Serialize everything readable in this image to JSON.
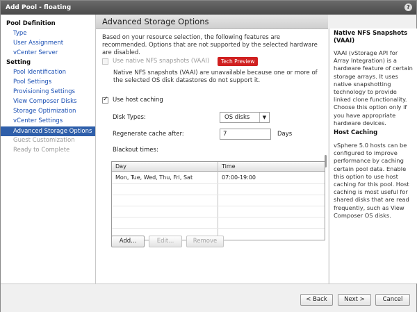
{
  "window": {
    "title": "Add Pool - floating",
    "help_glyph": "?"
  },
  "sidebar": {
    "sections": [
      {
        "label": "Pool Definition"
      },
      {
        "label": "Setting"
      }
    ],
    "items": [
      {
        "label": "Type",
        "state": "link"
      },
      {
        "label": "User Assignment",
        "state": "link"
      },
      {
        "label": "vCenter Server",
        "state": "link"
      },
      {
        "label": "Pool Identification",
        "state": "link"
      },
      {
        "label": "Pool Settings",
        "state": "link"
      },
      {
        "label": "Provisioning Settings",
        "state": "link"
      },
      {
        "label": "View Composer Disks",
        "state": "link"
      },
      {
        "label": "Storage Optimization",
        "state": "link"
      },
      {
        "label": "vCenter Settings",
        "state": "link"
      },
      {
        "label": "Advanced Storage Options",
        "state": "active"
      },
      {
        "label": "Guest Customization",
        "state": "disabled"
      },
      {
        "label": "Ready to Complete",
        "state": "disabled"
      }
    ]
  },
  "main": {
    "title": "Advanced Storage Options",
    "intro": "Based on your resource selection, the following features are recommended. Options that are not supported by the selected hardware are disabled.",
    "vaai": {
      "label": "Use native NFS snapshots (VAAI)",
      "checked": false,
      "enabled": false,
      "badge": "Tech Preview",
      "badge_color": "#d02020",
      "note": "Native NFS snapshots (VAAI) are unavailable because one or more of the selected OS disk datastores do not support it."
    },
    "host_caching": {
      "label": "Use host caching",
      "checked": true,
      "disk_types_label": "Disk Types:",
      "disk_types_value": "OS disks",
      "regenerate_label": "Regenerate cache after:",
      "regenerate_value": "7",
      "regenerate_unit": "Days",
      "blackout_label": "Blackout times:"
    },
    "blackout_table": {
      "columns": [
        "Day",
        "Time"
      ],
      "rows": [
        {
          "day": "Mon, Tue, Wed, Thu, Fri, Sat",
          "time": "07:00-19:00"
        }
      ]
    },
    "buttons": {
      "add": "Add...",
      "edit": "Edit...",
      "remove": "Remove"
    }
  },
  "help_panel": {
    "section1_title": "Native NFS Snapshots (VAAI)",
    "section1_text": "VAAI (vStorage API for Array Integration) is a hardware feature of certain storage arrays. It uses native snapshotting technology to provide linked clone functionality. Choose this option only if you have appropriate hardware devices.",
    "section2_title": "Host Caching",
    "section2_text": "vSphere 5.0 hosts can be configured to improve performance by caching certain pool data. Enable this option to use host caching for this pool. Host caching is most useful for shared disks that are read frequently, such as View Composer OS disks."
  },
  "footer": {
    "back": "< Back",
    "next": "Next >",
    "cancel": "Cancel"
  },
  "colors": {
    "accent": "#2f5faa",
    "link": "#1a4fb3",
    "header": "#4a4a4a"
  }
}
